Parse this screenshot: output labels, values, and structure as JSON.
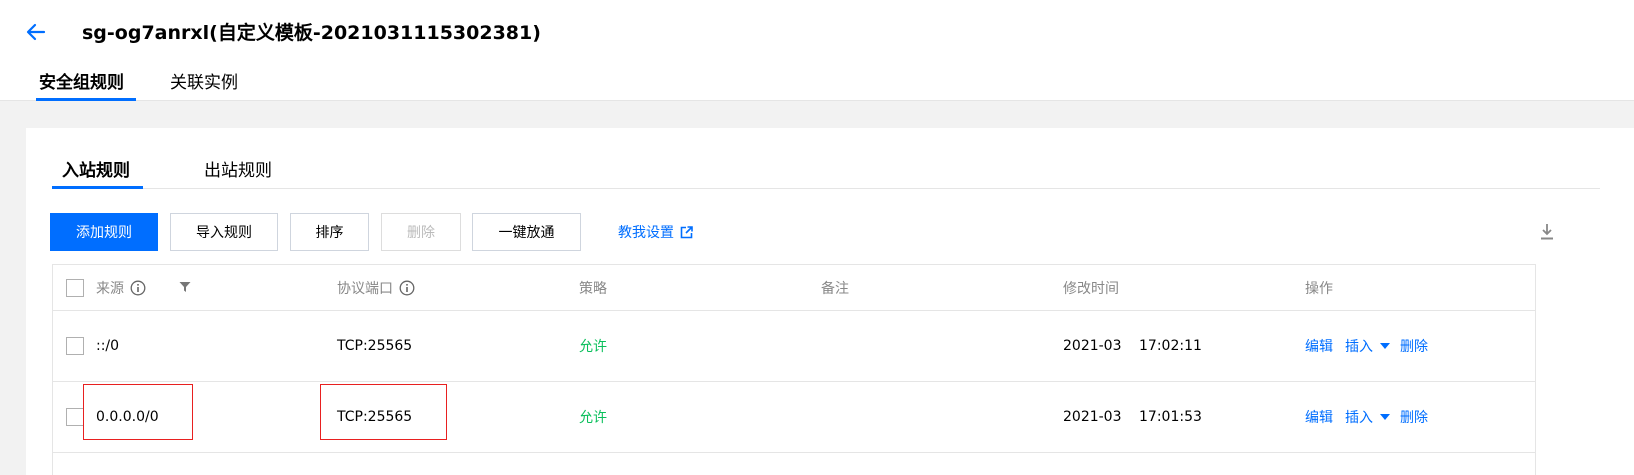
{
  "header": {
    "title": "sg-og7anrxl(自定义模板-2021031115302381)",
    "tabs": [
      {
        "label": "安全组规则",
        "active": true
      },
      {
        "label": "关联实例",
        "active": false
      }
    ]
  },
  "rules": {
    "tabs": [
      {
        "label": "入站规则",
        "active": true
      },
      {
        "label": "出站规则",
        "active": false
      }
    ],
    "toolbar": {
      "add_label": "添加规则",
      "import_label": "导入规则",
      "sort_label": "排序",
      "delete_label": "删除",
      "allow_all_label": "一键放通",
      "help_label": "教我设置"
    },
    "table": {
      "columns": [
        "来源",
        "协议端口",
        "策略",
        "备注",
        "修改时间",
        "操作"
      ],
      "rows": [
        {
          "source": "::/0",
          "protocol_port": "TCP:25565",
          "policy": "允许",
          "note": "",
          "modified_date": "2021-03",
          "modified_time": "17:02:11",
          "actions": {
            "edit": "编辑",
            "insert": "插入",
            "delete": "删除"
          }
        },
        {
          "source": "0.0.0.0/0",
          "protocol_port": "TCP:25565",
          "policy": "允许",
          "note": "",
          "modified_date": "2021-03",
          "modified_time": "17:01:53",
          "actions": {
            "edit": "编辑",
            "insert": "插入",
            "delete": "删除"
          }
        }
      ]
    }
  },
  "colors": {
    "accent": "#006eff",
    "allow": "#0abf5b",
    "highlight": "#e82020"
  }
}
